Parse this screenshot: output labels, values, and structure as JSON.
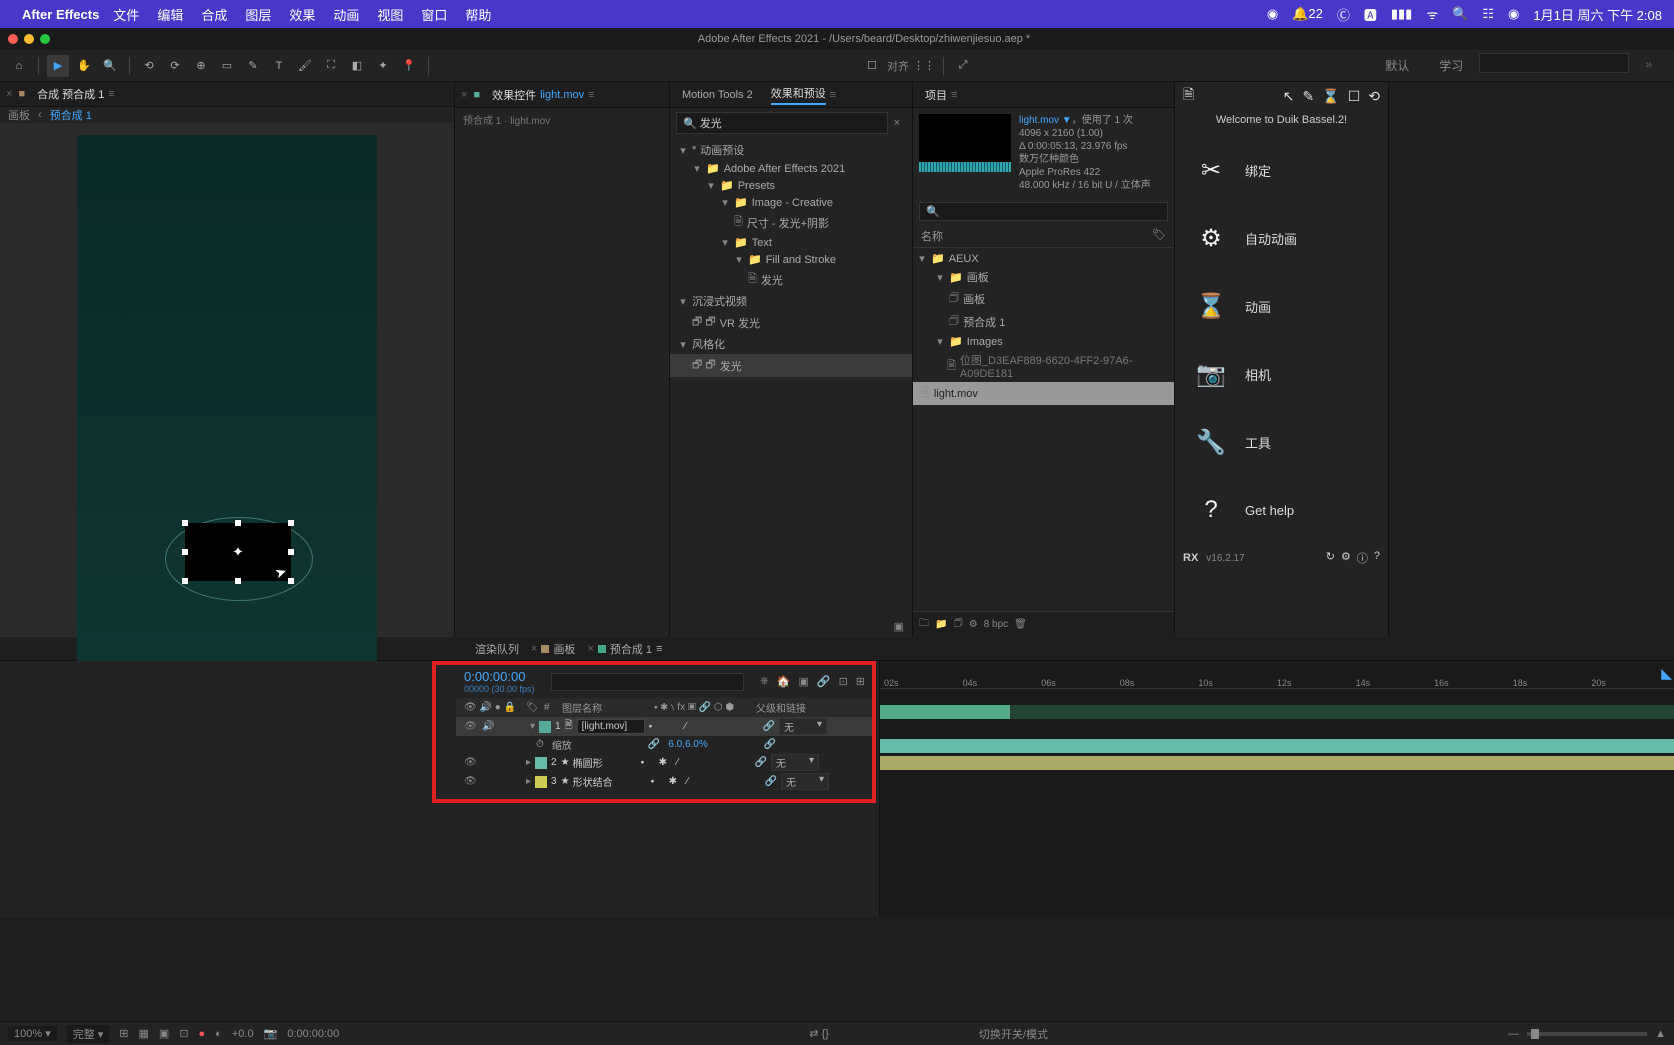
{
  "mac_menu": {
    "app": "After Effects",
    "items": [
      "文件",
      "编辑",
      "合成",
      "图层",
      "效果",
      "动画",
      "视图",
      "窗口",
      "帮助"
    ],
    "notif_count": "22",
    "clock": "1月1日 周六 下午 2:08"
  },
  "window_title": "Adobe After Effects 2021 - /Users/beard/Desktop/zhiwenjiesuo.aep *",
  "workspace_tabs": [
    "默认",
    "学习"
  ],
  "comp_panel": {
    "tab": "合成 预合成 1",
    "breadcrumb_root": "画板",
    "breadcrumb_cur": "预合成 1"
  },
  "fx_panel": {
    "tab_prefix": "效果控件",
    "tab_item": "light.mov",
    "bread": "预合成 1 · light.mov"
  },
  "mid_tabs": {
    "motion_tools": "Motion Tools 2",
    "effects_presets": "效果和预设"
  },
  "effects_search": "发光",
  "effects_tree": {
    "a": "动画预设",
    "b": "Adobe After Effects 2021",
    "c": "Presets",
    "d": "Image - Creative",
    "e": "尺寸 - 发光+阴影",
    "f": "Text",
    "g": "Fill and Stroke",
    "h": "发光",
    "i": "沉浸式视频",
    "j": "VR 发光",
    "k": "风格化",
    "l": "发光"
  },
  "project": {
    "tab": "项目",
    "sel_name": "light.mov ▼",
    "sel_used": "，使用了 1 次",
    "dims": "4096 x 2160 (1.00)",
    "dur": "Δ 0:00:05:13, 23.976 fps",
    "colors": "数万亿种颜色",
    "codec": "Apple ProRes 422",
    "audio": "48.000 kHz / 16 bit U / 立体声",
    "search_ph": "🔍",
    "col_name": "名称",
    "tree": {
      "a": "AEUX",
      "b": "画板",
      "c": "画板",
      "d": "预合成 1",
      "e": "Images",
      "f": "位图_D3EAF889-6620-4FF2-97A6-A09DE181",
      "g": "light.mov"
    },
    "bpc": "8 bpc"
  },
  "duik": {
    "welcome": "Welcome to Duik Bassel.2!",
    "btns": [
      "绑定",
      "自动动画",
      "动画",
      "相机",
      "工具",
      "Get help"
    ],
    "version": "v16.2.17"
  },
  "timeline_tabs": {
    "render_q": "渲染队列",
    "comp_a": "画板",
    "comp_b": "预合成 1"
  },
  "timeline": {
    "timecode": "0:00:00:00",
    "timesub": "00000 (30.00 fps)",
    "hdr_name": "图层名称",
    "hdr_parent": "父级和链接",
    "layers": [
      {
        "num": "1",
        "name": "[light.mov]",
        "parent": "无"
      },
      {
        "num": "2",
        "name": "椭圆形",
        "parent": "无"
      },
      {
        "num": "3",
        "name": "形状结合",
        "parent": "无"
      }
    ],
    "scale_label": "缩放",
    "scale_val": "6.0,6.0%",
    "ruler": [
      "02s",
      "04s",
      "06s",
      "08s",
      "10s",
      "12s",
      "14s",
      "16s",
      "18s",
      "20s"
    ]
  },
  "footer": {
    "zoom": "100%",
    "res": "完整",
    "exposure": "+0.0",
    "time": "0:00:00:00",
    "switches": "切换开关/模式"
  },
  "snap_label": "对齐"
}
